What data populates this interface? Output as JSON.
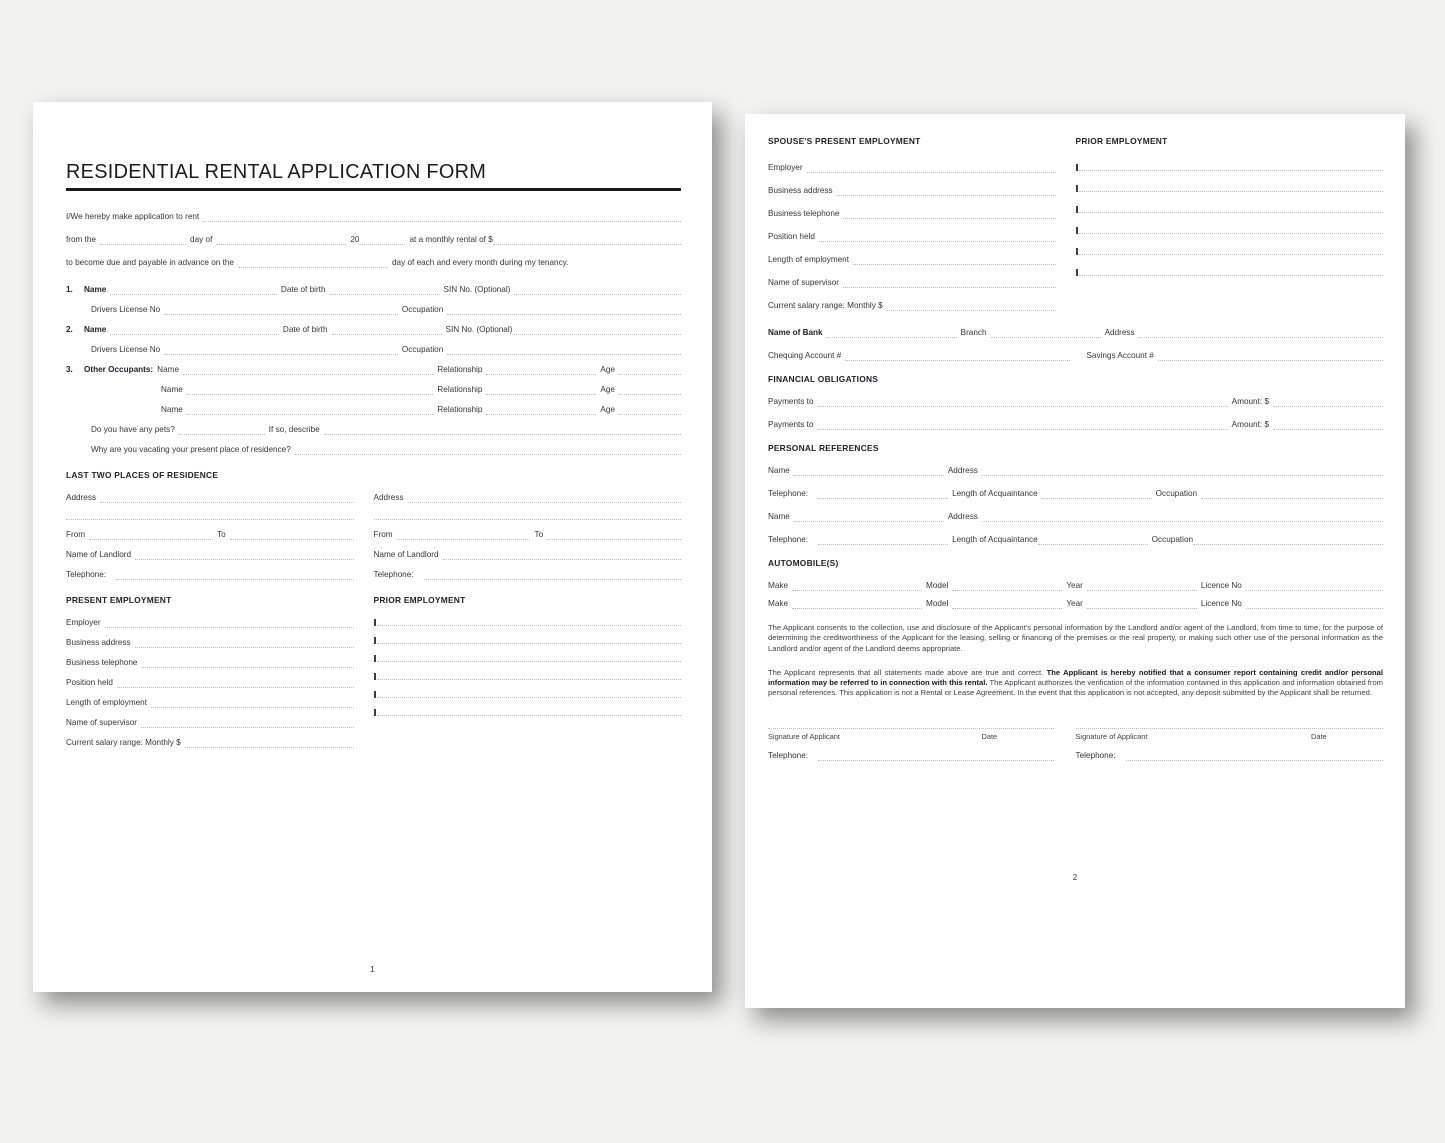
{
  "document": {
    "title": "RESIDENTIAL RENTAL APPLICATION FORM"
  },
  "page1": {
    "page_number": "1",
    "intro": {
      "line1_label": "I/We hereby make application to rent",
      "line2_a": "from the",
      "line2_b": "day of",
      "line2_c": "20",
      "line2_d": "at a monthly rental of $",
      "line3_a": "to become due and payable in advance on the",
      "line3_b": "day of each and every month during my tenancy."
    },
    "applicants": [
      {
        "num": "1.",
        "name_label": "Name",
        "dob_label": "Date of birth",
        "sin_label": "SIN No. (Optional)",
        "license_label": "Drivers License No",
        "occupation_label": "Occupation"
      },
      {
        "num": "2.",
        "name_label": "Name",
        "dob_label": "Date of birth",
        "sin_label": "SIN No. (Optional)",
        "license_label": "Drivers License No",
        "occupation_label": "Occupation"
      }
    ],
    "other_occupants": {
      "num": "3.",
      "heading": "Other Occupants:",
      "name_label": "Name",
      "relationship_label": "Relationship",
      "age_label": "Age",
      "rows": 3,
      "pets_label": "Do you have any pets?",
      "pets_describe_label": "If so, describe",
      "vacating_label": "Why are you vacating your present place of residence?"
    },
    "residence": {
      "heading": "LAST TWO PLACES OF RESIDENCE",
      "address_label": "Address",
      "from_label": "From",
      "to_label": "To",
      "landlord_label": "Name of Landlord",
      "telephone_label": "Telephone:"
    },
    "employment": {
      "present_heading": "PRESENT EMPLOYMENT",
      "prior_heading": "PRIOR EMPLOYMENT",
      "fields": [
        "Employer",
        "Business address",
        "Business telephone",
        "Position held",
        "Length of employment",
        "Name of supervisor"
      ],
      "salary_label": "Current salary range: Monthly $"
    }
  },
  "page2": {
    "page_number": "2",
    "employment": {
      "spouse_heading": "SPOUSE'S PRESENT EMPLOYMENT",
      "prior_heading": "PRIOR EMPLOYMENT",
      "fields": [
        "Employer",
        "Business address",
        "Business telephone",
        "Position held",
        "Length of employment",
        "Name of supervisor"
      ],
      "salary_label": "Current salary range: Monthly $"
    },
    "bank": {
      "name_label": "Name of Bank",
      "branch_label": "Branch",
      "address_label": "Address",
      "chequing_label": "Chequing Account #",
      "savings_label": "Savings Account #"
    },
    "financial": {
      "heading": "FINANCIAL OBLIGATIONS",
      "payments_label": "Payments to",
      "amount_label": "Amount: $",
      "rows": 2
    },
    "references": {
      "heading": "PERSONAL REFERENCES",
      "name_label": "Name",
      "address_label": "Address",
      "telephone_label": "Telephone:",
      "acquaintance_label": "Length of Acquaintance",
      "occupation_label": "Occupation",
      "rows": 2
    },
    "automobiles": {
      "heading": "AUTOMOBILE(S)",
      "make_label": "Make",
      "model_label": "Model",
      "year_label": "Year",
      "licence_label": "Licence No",
      "rows": 2
    },
    "consent_paragraph": "The Applicant consents to the collection, use and disclosure of the Applicant's personal information by the Landlord and/or agent of the Landlord, from time to time, for the purpose of determining the creditworthiness of the Applicant for the leasing, selling or financing of the premises or the real property, or making such other use of the personal information as the Landlord and/or agent of the Landlord deems appropriate.",
    "representation_paragraph": {
      "part1": "The Applicant represents that all statements made above are true and correct. ",
      "bold": "The Applicant is hereby notified that a consumer report containing credit and/or personal information may be referred to in connection with this rental.",
      "part2": " The Applicant authorizes the verification of the information contained in this application and information obtained from personal references. This application is not a Rental or Lease Agreement. In the event that this application is not accepted, any deposit submitted by the Applicant shall be returned."
    },
    "signature": {
      "signature_label": "Signature of Applicant",
      "date_label": "Date",
      "telephone_label": "Telephone:"
    }
  }
}
